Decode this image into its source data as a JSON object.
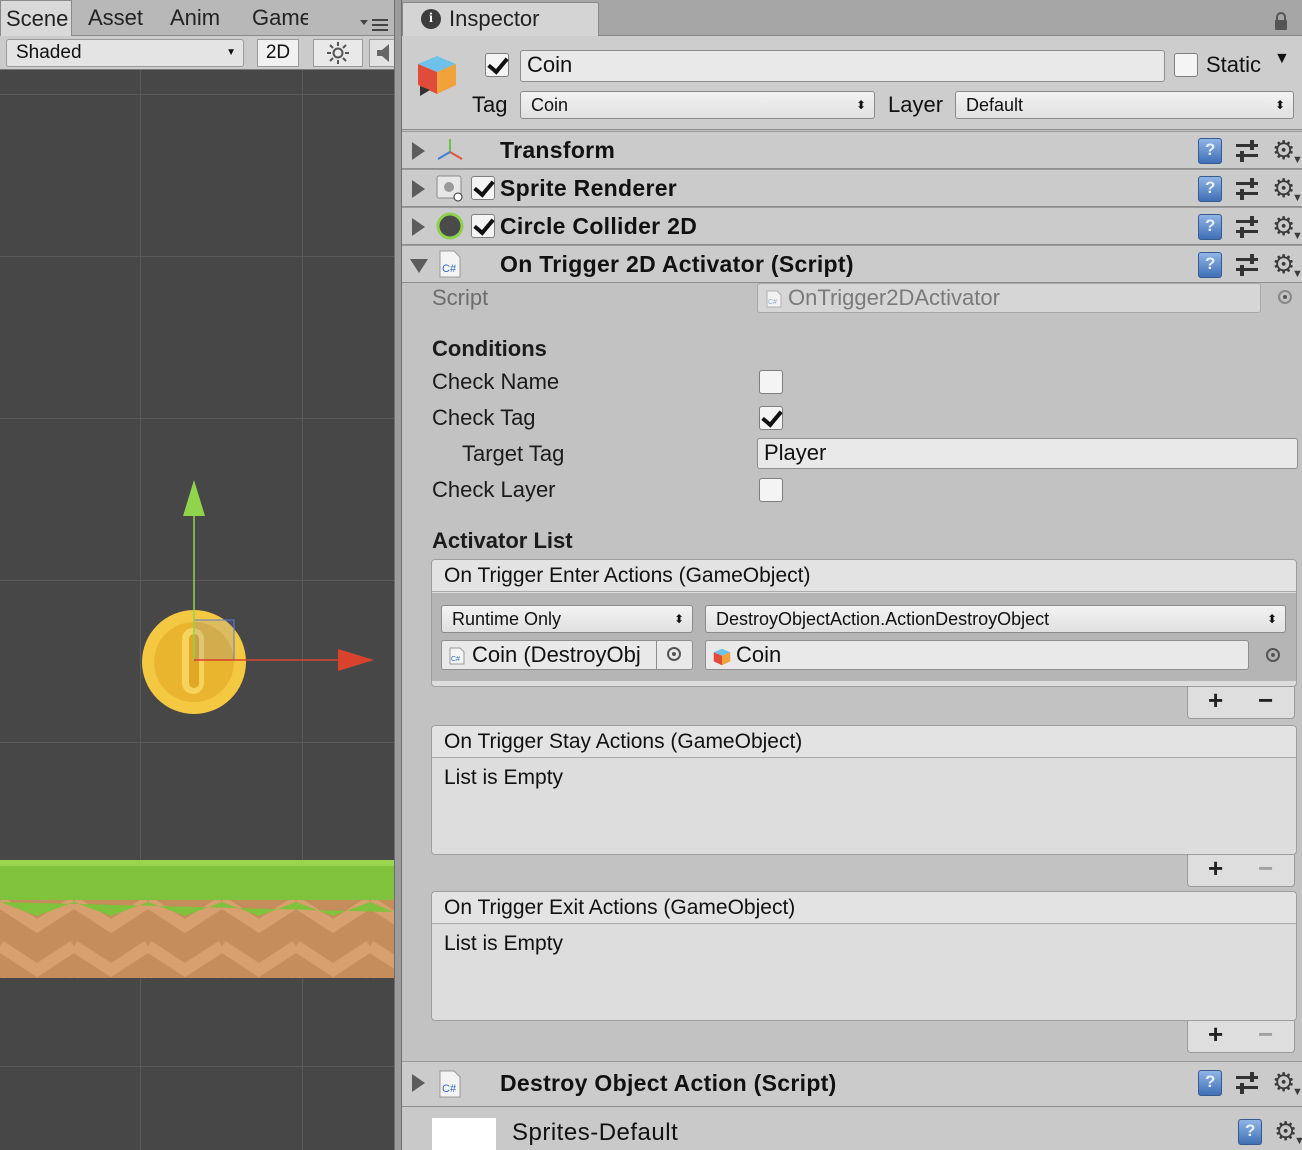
{
  "left_tabs": [
    "Scene",
    "Asset",
    "Anim",
    "Game"
  ],
  "scene_toolbar": {
    "shading_mode": "Shaded",
    "mode_2d": "2D"
  },
  "inspector": {
    "tab_label": "Inspector",
    "gameobject": {
      "name": "Coin",
      "active": true,
      "static_label": "Static",
      "static": false,
      "tag_label": "Tag",
      "tag_value": "Coin",
      "layer_label": "Layer",
      "layer_value": "Default"
    },
    "components": [
      {
        "title": "Transform",
        "icon": "transform-axes-icon"
      },
      {
        "title": "Sprite Renderer",
        "icon": "sprite-renderer-icon",
        "enabled": true
      },
      {
        "title": "Circle Collider 2D",
        "icon": "circle-collider-icon",
        "enabled": true
      },
      {
        "title": "On Trigger 2D Activator (Script)",
        "icon": "csharp-script-icon",
        "expanded": true
      },
      {
        "title": "Destroy Object Action (Script)",
        "icon": "csharp-script-icon"
      }
    ],
    "activator": {
      "script_label": "Script",
      "script_value": "OnTrigger2DActivator",
      "conditions_label": "Conditions",
      "check_name_label": "Check Name",
      "check_name": false,
      "check_tag_label": "Check Tag",
      "check_tag": true,
      "target_tag_label": "Target Tag",
      "target_tag_value": "Player",
      "check_layer_label": "Check Layer",
      "check_layer": false,
      "activator_list_label": "Activator List",
      "enter_actions": {
        "title": "On Trigger Enter Actions (GameObject)",
        "call_state": "Runtime Only",
        "function": "DestroyObjectAction.ActionDestroyObject",
        "target_object": "Coin (DestroyObj",
        "argument_object": "Coin"
      },
      "stay_actions": {
        "title": "On Trigger Stay Actions (GameObject)",
        "empty_text": "List is Empty"
      },
      "exit_actions": {
        "title": "On Trigger Exit Actions (GameObject)",
        "empty_text": "List is Empty"
      },
      "plus": "+",
      "minus": "−"
    },
    "material": {
      "name": "Sprites-Default"
    }
  },
  "colors": {
    "scene_bg": "#474747",
    "coin": "#f5c842",
    "y_axis": "#8fd44a",
    "x_axis": "#d9432e",
    "grass": "#7fc23b",
    "dirt": "#c58d5c"
  }
}
